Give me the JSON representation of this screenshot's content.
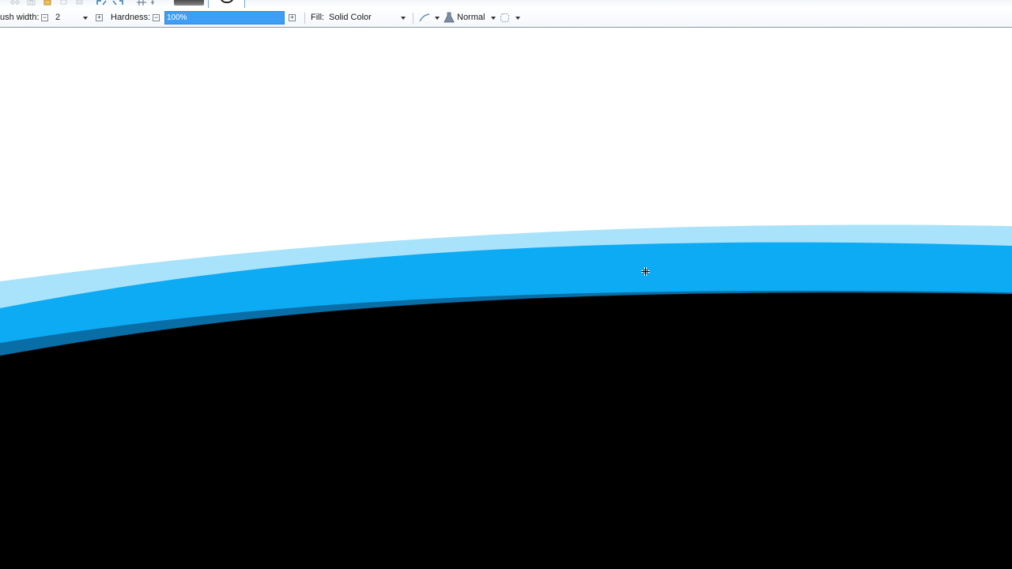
{
  "toolbar": {
    "brush_width_label": "ush width:",
    "brush_width_value": "2",
    "hardness_label": "Hardness:",
    "hardness_value": "100%",
    "fill_label": "Fill:",
    "fill_value": "Solid Color",
    "blend_mode": "Normal"
  },
  "icons": {
    "cut": "cut-icon",
    "copy": "copy-icon",
    "paste": "paste-icon",
    "crop": "crop-icon",
    "deselect": "deselect-icon",
    "undo": "undo-icon",
    "redo": "redo-icon",
    "grid": "grid-icon",
    "antialias": "antialiasing-icon",
    "blend": "alpha-blending-icon",
    "selection_mode": "selection-mode-icon",
    "cursor": "crosshair-cursor-icon"
  },
  "colors": {
    "accent": "#3d9ef5",
    "band_light": "#a9e3fb",
    "band_main": "#0eabf5",
    "band_dark": "#0a6ea6",
    "fill_black": "#000000"
  }
}
